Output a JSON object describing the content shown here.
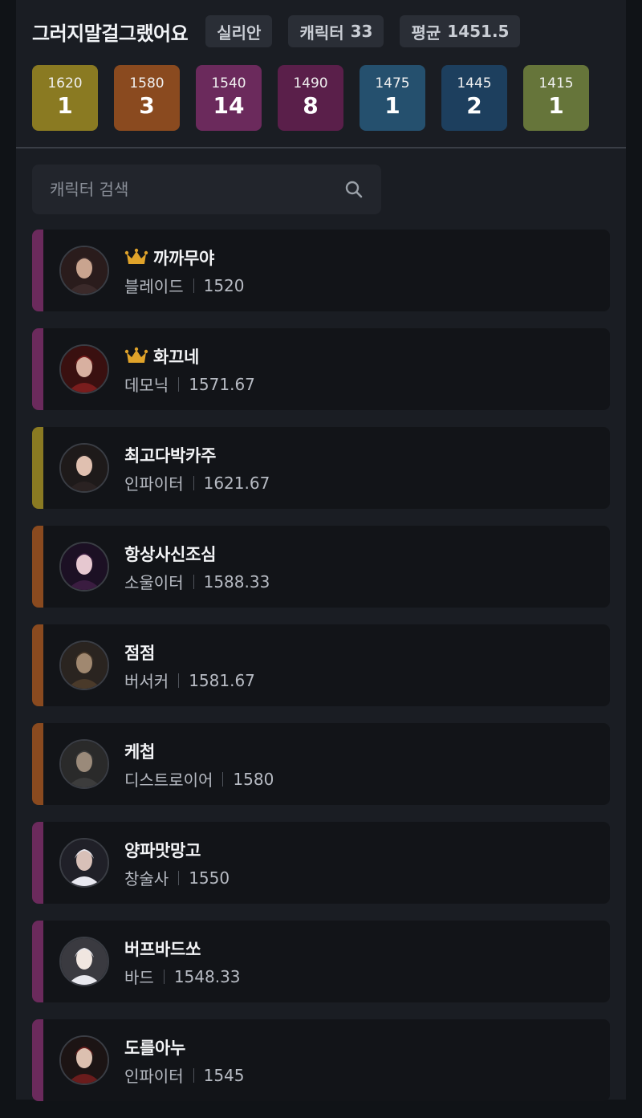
{
  "header": {
    "guild_name": "그러지말걸그랬어요",
    "server": "실리안",
    "character_label": "캐릭터",
    "character_count": "33",
    "average_label": "평균",
    "average_value": "1451.5"
  },
  "tiers": [
    {
      "level": "1620",
      "count": "1",
      "color": "#8a7a22"
    },
    {
      "level": "1580",
      "count": "3",
      "color": "#8a4a1f"
    },
    {
      "level": "1540",
      "count": "14",
      "color": "#6b2a5c"
    },
    {
      "level": "1490",
      "count": "8",
      "color": "#5a1f4a"
    },
    {
      "level": "1475",
      "count": "1",
      "color": "#25506e"
    },
    {
      "level": "1445",
      "count": "2",
      "color": "#1d3f5e"
    },
    {
      "level": "1415",
      "count": "1",
      "color": "#66753a"
    }
  ],
  "search": {
    "placeholder": "캐릭터 검색",
    "icon": "search-icon"
  },
  "characters": [
    {
      "name": "까까무야",
      "crown": true,
      "class": "블레이드",
      "item_level": "1520",
      "bar_color": "#6b2a5c"
    },
    {
      "name": "화끄네",
      "crown": true,
      "class": "데모닉",
      "item_level": "1571.67",
      "bar_color": "#6b2a5c"
    },
    {
      "name": "최고다박카주",
      "crown": false,
      "class": "인파이터",
      "item_level": "1621.67",
      "bar_color": "#8a7a22"
    },
    {
      "name": "항상사신조심",
      "crown": false,
      "class": "소울이터",
      "item_level": "1588.33",
      "bar_color": "#8a4a1f"
    },
    {
      "name": "점점",
      "crown": false,
      "class": "버서커",
      "item_level": "1581.67",
      "bar_color": "#8a4a1f"
    },
    {
      "name": "케첩",
      "crown": false,
      "class": "디스트로이어",
      "item_level": "1580",
      "bar_color": "#8a4a1f"
    },
    {
      "name": "양파맛망고",
      "crown": false,
      "class": "창술사",
      "item_level": "1550",
      "bar_color": "#6b2a5c"
    },
    {
      "name": "버프바드쏘",
      "crown": false,
      "class": "바드",
      "item_level": "1548.33",
      "bar_color": "#6b2a5c"
    },
    {
      "name": "도를아누",
      "crown": false,
      "class": "인파이터",
      "item_level": "1545",
      "bar_color": "#6b2a5c"
    }
  ],
  "colors": {
    "background": "#101317",
    "panel": "#1a1d23",
    "card": "#121418",
    "crown": "#e0a32a"
  }
}
